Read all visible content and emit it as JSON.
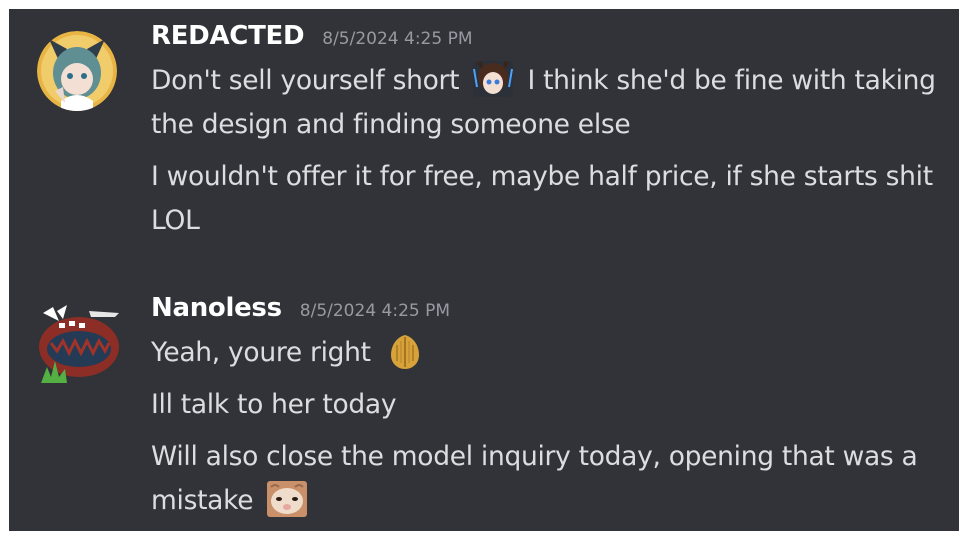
{
  "messages": [
    {
      "author": "REDACTED",
      "timestamp": "8/5/2024 4:25 PM",
      "avatar_icon": "cat-girl-avatar-icon",
      "lines": [
        {
          "before": "Don't sell yourself short",
          "emoji": "anime-girl-emoji-icon",
          "after": "I think she'd be fine with taking the design and finding someone else"
        },
        {
          "text": "I wouldn't offer it for free, maybe half price, if she starts shit LOL"
        }
      ]
    },
    {
      "author": "Nanoless",
      "timestamp": "8/5/2024 4:25 PM",
      "avatar_icon": "red-monster-avatar-icon",
      "lines": [
        {
          "before": "Yeah, youre right",
          "emoji": "hands-together-emoji-icon"
        },
        {
          "text": "Ill talk to her today"
        },
        {
          "before": "Will also close the model inquiry today, opening that was a mistake",
          "emoji": "hamster-emoji-icon"
        }
      ]
    }
  ],
  "colors": {
    "background": "#313338",
    "username": "#ffffff",
    "message_text": "#dbdee1",
    "timestamp": "#989aa2"
  }
}
